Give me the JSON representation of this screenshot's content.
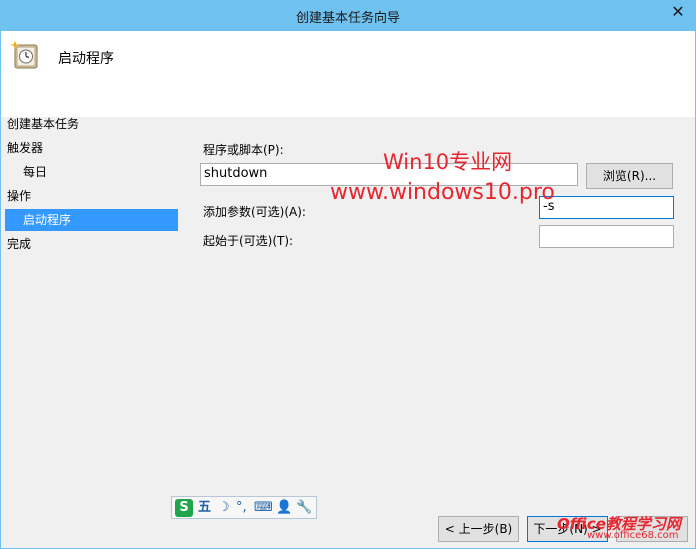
{
  "window": {
    "title": "创建基本任务向导",
    "close_glyph": "✕"
  },
  "header": {
    "title": "启动程序"
  },
  "nav": {
    "items": [
      {
        "label": "创建基本任务"
      },
      {
        "label": "触发器"
      },
      {
        "label": "每日"
      },
      {
        "label": "操作"
      },
      {
        "label": "启动程序"
      },
      {
        "label": "完成"
      }
    ]
  },
  "form": {
    "program_label": "程序或脚本(P):",
    "program_value": "shutdown",
    "browse_label": "浏览(R)...",
    "args_label": "添加参数(可选)(A):",
    "args_value": "-s",
    "startin_label": "起始于(可选)(T):",
    "startin_value": ""
  },
  "footer": {
    "back_label": "< 上一步(B)",
    "next_label": "下一步(N) >"
  },
  "ime": {
    "logo": "S",
    "mode": "五",
    "moon": "☽",
    "punc": "°,",
    "keyboard": "⌨",
    "user": "👤",
    "tool": "🔧"
  },
  "watermarks": {
    "line1": "Win10专业网",
    "line2": "www.windows10.pro",
    "line3": "Office教程学习网",
    "line4": "www.office68.com"
  }
}
